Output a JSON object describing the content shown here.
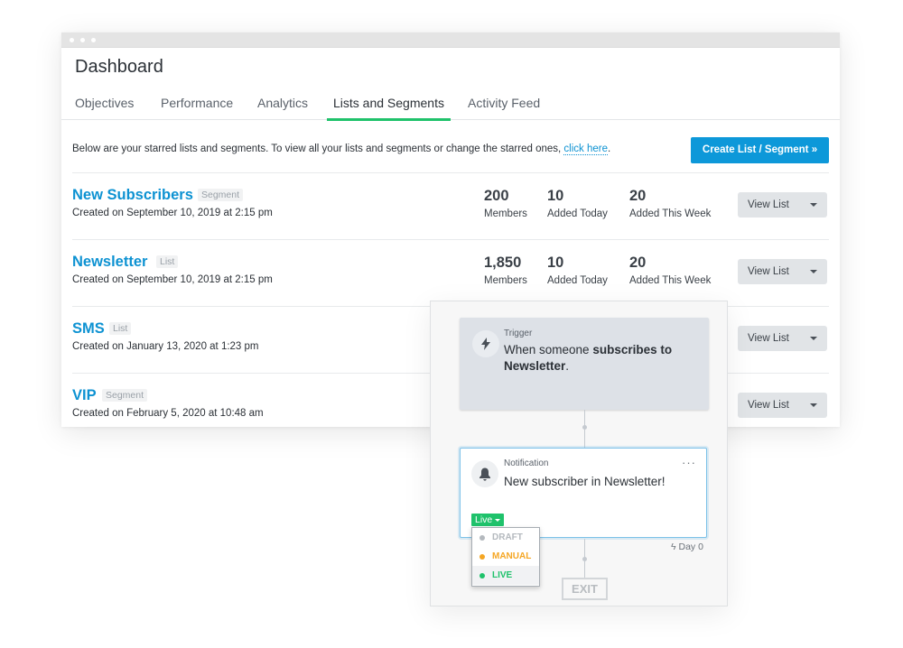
{
  "window": {
    "title": "Dashboard",
    "tabs": [
      {
        "label": "Objectives",
        "active": false
      },
      {
        "label": "Performance",
        "active": false
      },
      {
        "label": "Analytics",
        "active": false
      },
      {
        "label": "Lists and Segments",
        "active": true
      },
      {
        "label": "Activity Feed",
        "active": false
      }
    ]
  },
  "intro": {
    "text": "Below are your starred lists and segments. To view all your lists and segments or change the starred ones, ",
    "link": "click here",
    "suffix": "."
  },
  "create_button": "Create List / Segment »",
  "stat_labels": {
    "members": "Members",
    "today": "Added Today",
    "week": "Added This Week"
  },
  "view_button": "View List",
  "rows": [
    {
      "name": "New Subscribers",
      "type": "Segment",
      "created": "Created on September 10, 2019 at 2:15 pm",
      "members": "200",
      "today": "10",
      "week": "20"
    },
    {
      "name": "Newsletter",
      "type": "List",
      "created": "Created on September 10, 2019 at 2:15 pm",
      "members": "1,850",
      "today": "10",
      "week": "20"
    },
    {
      "name": "SMS",
      "type": "List",
      "created": "Created on January 13, 2020 at 1:23 pm"
    },
    {
      "name": "VIP",
      "type": "Segment",
      "created": "Created on February 5, 2020 at 10:48 am"
    }
  ],
  "flow": {
    "trigger": {
      "label": "Trigger",
      "text_prefix": "When someone ",
      "text_bold": "subscribes to Newsletter",
      "text_suffix": ".",
      "icon": "lightning-icon"
    },
    "notification": {
      "label": "Notification",
      "text": "New subscriber in Newsletter!",
      "icon": "bell-icon",
      "more": "···"
    },
    "status_badge": "Live",
    "status_options": [
      {
        "label": "DRAFT",
        "color": "#b4b9be"
      },
      {
        "label": "MANUAL",
        "color": "#f5a623"
      },
      {
        "label": "LIVE",
        "color": "#1fc26b"
      }
    ],
    "selected_status": "LIVE",
    "day_label": "Day 0",
    "exit_label": "EXIT"
  },
  "colors": {
    "accent_blue": "#0d98d9",
    "tab_active": "#1fc26b",
    "live_green": "#1fc26b"
  }
}
